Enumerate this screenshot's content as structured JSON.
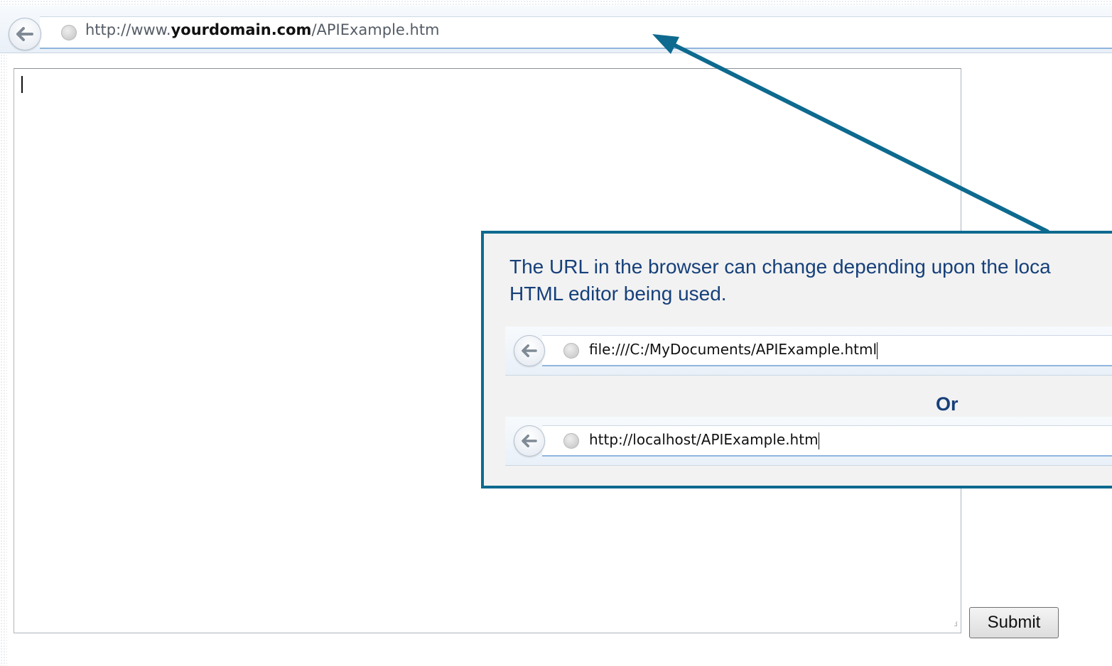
{
  "browser": {
    "url_prefix": "http://www.",
    "url_domain": "yourdomain.com",
    "url_path": "/APIExample.htm",
    "back_icon": "back-arrow-icon",
    "site_icon": "globe-icon"
  },
  "form": {
    "textarea_value": "",
    "submit_label": "Submit"
  },
  "callout": {
    "line1": "The URL in the browser can change depending upon the loca",
    "line2": "HTML editor being used.",
    "example1_url": "file:///C:/MyDocuments/APIExample.html",
    "or_label": "Or",
    "example2_url": "http://localhost/APIExample.htm"
  },
  "colors": {
    "callout_border": "#0e6a8f",
    "callout_text": "#16407a",
    "arrow": "#0e6a8f"
  }
}
